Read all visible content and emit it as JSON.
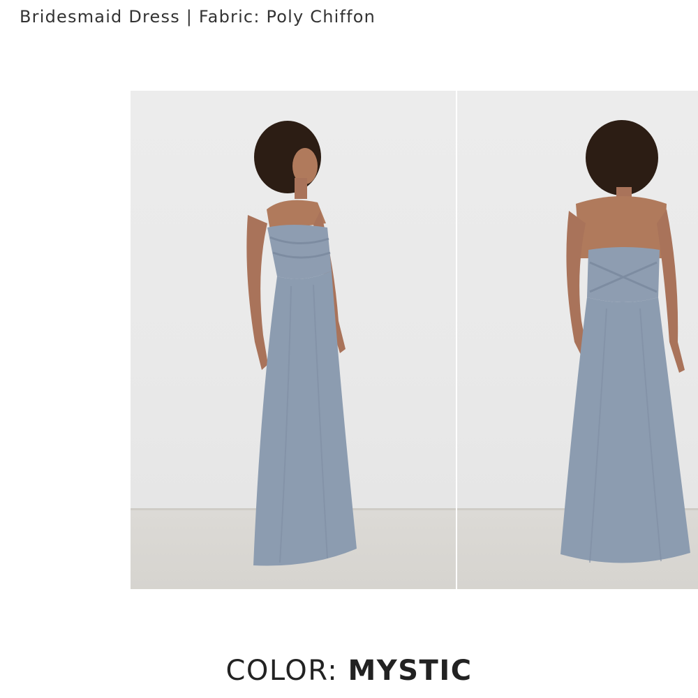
{
  "product": {
    "title": "Bridesmaid Dress | Fabric: Poly Chiffon"
  },
  "gallery": {
    "images": [
      {
        "name": "front-view",
        "dress_color": "#8c9cb0"
      },
      {
        "name": "back-view",
        "dress_color": "#8c9cb0"
      }
    ]
  },
  "color_selector": {
    "label": "COLOR:",
    "value": "MYSTIC"
  },
  "colors": {
    "text": "#222222",
    "dress": "#8c9cb0",
    "background": "#ffffff"
  }
}
